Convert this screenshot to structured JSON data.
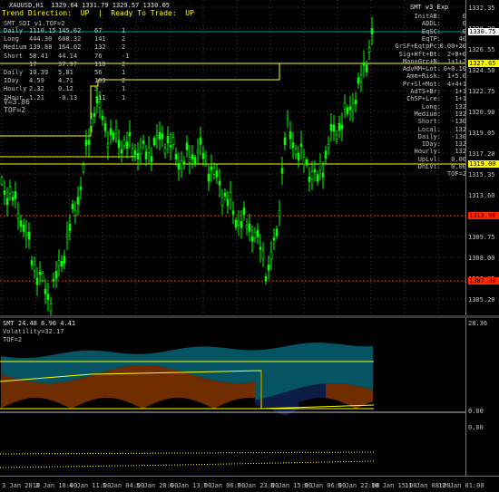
{
  "main": {
    "symbol_header": "XAUUSD,H1  1329.64 1331.79 1329.57 1330.05",
    "trend_line": "Trend Direction:  UP  |  Ready To Trade:  UP",
    "stat_header": "SMT_SDI_v1.TOF=2",
    "stats_table": [
      [
        "Daily",
        "1110.15",
        "145.62",
        "67",
        "1"
      ],
      [
        "Long",
        "444.30",
        "608.32",
        "141",
        "2"
      ],
      [
        "Medium",
        "139.88",
        "164.02",
        "132",
        "2"
      ],
      [
        "Short",
        "58.41",
        "44.14",
        "76",
        "-1"
      ],
      [
        "",
        "17",
        "37.97",
        "118",
        "2"
      ],
      [
        "Daily",
        "10.39",
        "5.81",
        "56",
        "1"
      ],
      [
        "IDay",
        "4.59",
        "4.71",
        "103",
        "2"
      ],
      [
        "Hourly",
        "2.32",
        "0.12",
        "5",
        "1"
      ],
      [
        "IHour",
        "1.21",
        "-0.13",
        "-11",
        "1"
      ]
    ],
    "v_line": "V=3.86",
    "tof_line": "TOF=2",
    "right_title": "SMT v3_Exp",
    "right_panel": [
      [
        "InitAB:",
        "0"
      ],
      [
        "ADDL:",
        "0"
      ],
      [
        "EqSC:",
        "0"
      ],
      [
        "EqTP:",
        "40"
      ],
      [
        "GrSF+EqtpPc:",
        "0.00+20"
      ],
      [
        "Sig+Hft+Bt:",
        "2+0+0"
      ],
      [
        "Man+Grr+N:",
        "1+1+2"
      ],
      [
        "AdvMM+Lot:",
        "0+0.10"
      ],
      [
        "Amm+Risk:",
        "1+5.0"
      ],
      [
        "Pr+Sl+Mot:",
        "4+4+1"
      ],
      [
        "AdTS+Br:",
        "1+1"
      ],
      [
        "ChSP+Lre:",
        "1+1"
      ],
      [
        "Long:",
        "132"
      ],
      [
        "Medium:",
        "132"
      ],
      [
        "Short:",
        "-130"
      ],
      [
        "Local:",
        "132"
      ],
      [
        "Daily:",
        "-130"
      ],
      [
        "IDay:",
        "132"
      ],
      [
        "Hourly:",
        "132"
      ],
      [
        "UpLvl:",
        "0.00"
      ],
      [
        "DnLvl:",
        "0.00"
      ],
      [
        "",
        "TOF=2"
      ]
    ],
    "price_ticks": [
      "1332.35",
      "1328.30",
      "1326.55",
      "1324.50",
      "1322.75",
      "1320.90",
      "1319.05",
      "1317.20",
      "1315.35",
      "1313.60",
      "1311.60",
      "1309.75",
      "1308.00",
      "1306.05",
      "1305.20"
    ],
    "price_tags": [
      {
        "label": "1330.75",
        "color": "#ffffff"
      },
      {
        "label": "1327.65",
        "color": "#ffff00"
      },
      {
        "label": "1319.00",
        "color": "#ffff00"
      },
      {
        "label": "1313.90",
        "color": "#ff2a00"
      },
      {
        "label": "1307.30",
        "color": "#ff2a00"
      }
    ]
  },
  "indicator": {
    "title": "SMT 24.48 6.90 4.41",
    "volatility": "Volatility=32.17",
    "tof": "TOF=2",
    "ticks": [
      "28.36",
      "0.00",
      "0.00"
    ]
  },
  "x_axis": [
    "3 Jan 2010",
    "3 Jan 18:00",
    "4 Jan 11:00",
    "5 Jan 04:00",
    "5 Jan 20:00",
    "6 Jan 13:00",
    "7 Jan 06:00",
    "7 Jan 23:00",
    "8 Jan 15:00",
    "9 Jan 06:00",
    "9 Jan 22:00",
    "10 Jan 15:00",
    "11 Jan 08:00",
    "12 Jan 01:00"
  ],
  "colors": {
    "candle": "#00ff00",
    "level_line": "#ffff00",
    "grid": "#505050",
    "cyan_band": "#00c0e0",
    "orange_band": "#ff6a00"
  }
}
